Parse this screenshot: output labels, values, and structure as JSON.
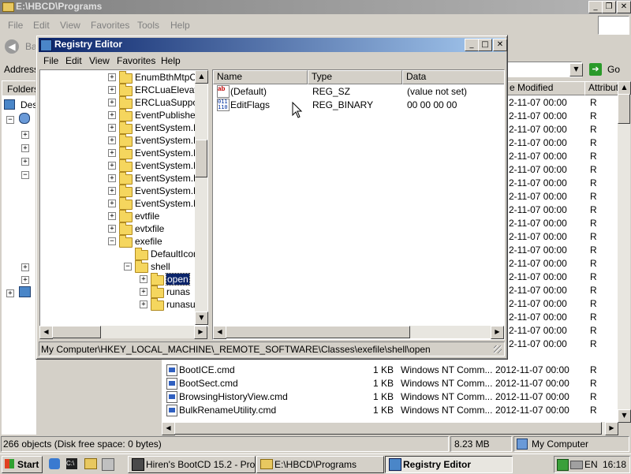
{
  "explorer": {
    "title": "E:\\HBCD\\Programs",
    "menu": [
      "File",
      "Edit",
      "View",
      "Favorites",
      "Tools",
      "Help"
    ],
    "address_label": "Address",
    "go_label": "Go",
    "back_label": "Ba",
    "folders_label": "Folders",
    "tree_partial": [
      "Des"
    ],
    "columns": {
      "modified": "e Modified",
      "attributes": "Attribut"
    },
    "right_rows_date": "2-11-07 00:00",
    "right_rows_attr": "R",
    "files": [
      {
        "name": "BootICE.cmd",
        "size": "1 KB",
        "type": "Windows NT Comm...",
        "modified": "2012-11-07 00:00",
        "attr": "R"
      },
      {
        "name": "BootSect.cmd",
        "size": "1 KB",
        "type": "Windows NT Comm...",
        "modified": "2012-11-07 00:00",
        "attr": "R"
      },
      {
        "name": "BrowsingHistoryView.cmd",
        "size": "1 KB",
        "type": "Windows NT Comm...",
        "modified": "2012-11-07 00:00",
        "attr": "R"
      },
      {
        "name": "BulkRenameUtility.cmd",
        "size": "1 KB",
        "type": "Windows NT Comm...",
        "modified": "2012-11-07 00:00",
        "attr": "R"
      }
    ],
    "status": {
      "objects": "266 objects (Disk free space: 0 bytes)",
      "size": "8.23 MB",
      "location": "My Computer"
    }
  },
  "regedit": {
    "title": "Registry Editor",
    "menu": [
      "File",
      "Edit",
      "View",
      "Favorites",
      "Help"
    ],
    "tree": [
      {
        "label": "EnumBthMtpCor",
        "level": 0,
        "expander": "+"
      },
      {
        "label": "ERCLuaElevatic",
        "level": 0,
        "expander": "+"
      },
      {
        "label": "ERCLuaSupport",
        "level": 0,
        "expander": "+"
      },
      {
        "label": "EventPublisher.E",
        "level": 0,
        "expander": "+"
      },
      {
        "label": "EventSystem.Ev",
        "level": 0,
        "expander": "+"
      },
      {
        "label": "EventSystem.Ev",
        "level": 0,
        "expander": "+"
      },
      {
        "label": "EventSystem.Ev",
        "level": 0,
        "expander": "+"
      },
      {
        "label": "EventSystem.Ev",
        "level": 0,
        "expander": "+"
      },
      {
        "label": "EventSystem.Ev",
        "level": 0,
        "expander": "+"
      },
      {
        "label": "EventSystem.Ev",
        "level": 0,
        "expander": "+"
      },
      {
        "label": "EventSystem.Ev",
        "level": 0,
        "expander": "+"
      },
      {
        "label": "evtfile",
        "level": 0,
        "expander": "+"
      },
      {
        "label": "evtxfile",
        "level": 0,
        "expander": "+"
      },
      {
        "label": "exefile",
        "level": 0,
        "expander": "-"
      },
      {
        "label": "DefaultIcon",
        "level": 1,
        "expander": ""
      },
      {
        "label": "shell",
        "level": 1,
        "expander": "-"
      },
      {
        "label": "open",
        "level": 2,
        "expander": "+",
        "selected": true
      },
      {
        "label": "runas",
        "level": 2,
        "expander": "+"
      },
      {
        "label": "runasuse",
        "level": 2,
        "expander": "+"
      }
    ],
    "columns": {
      "name": "Name",
      "type": "Type",
      "data": "Data"
    },
    "values": [
      {
        "name": "(Default)",
        "type": "REG_SZ",
        "data": "(value not set)",
        "icon": "string-value-icon"
      },
      {
        "name": "EditFlags",
        "type": "REG_BINARY",
        "data": "00 00 00 00",
        "icon": "binary-value-icon"
      }
    ],
    "status_path": "My Computer\\HKEY_LOCAL_MACHINE\\_REMOTE_SOFTWARE\\Classes\\exefile\\shell\\open"
  },
  "taskbar": {
    "start_label": "Start",
    "tasks": [
      {
        "label": "Hiren's BootCD 15.2 - Pro...",
        "active": false
      },
      {
        "label": "E:\\HBCD\\Programs",
        "active": false
      },
      {
        "label": "Registry Editor",
        "active": true
      }
    ],
    "language": "EN",
    "clock": "16:18"
  },
  "colors": {
    "title_active": "#0a246a",
    "title_inactive": "#808080",
    "face": "#d4d0c8",
    "selection": "#0a246a"
  }
}
